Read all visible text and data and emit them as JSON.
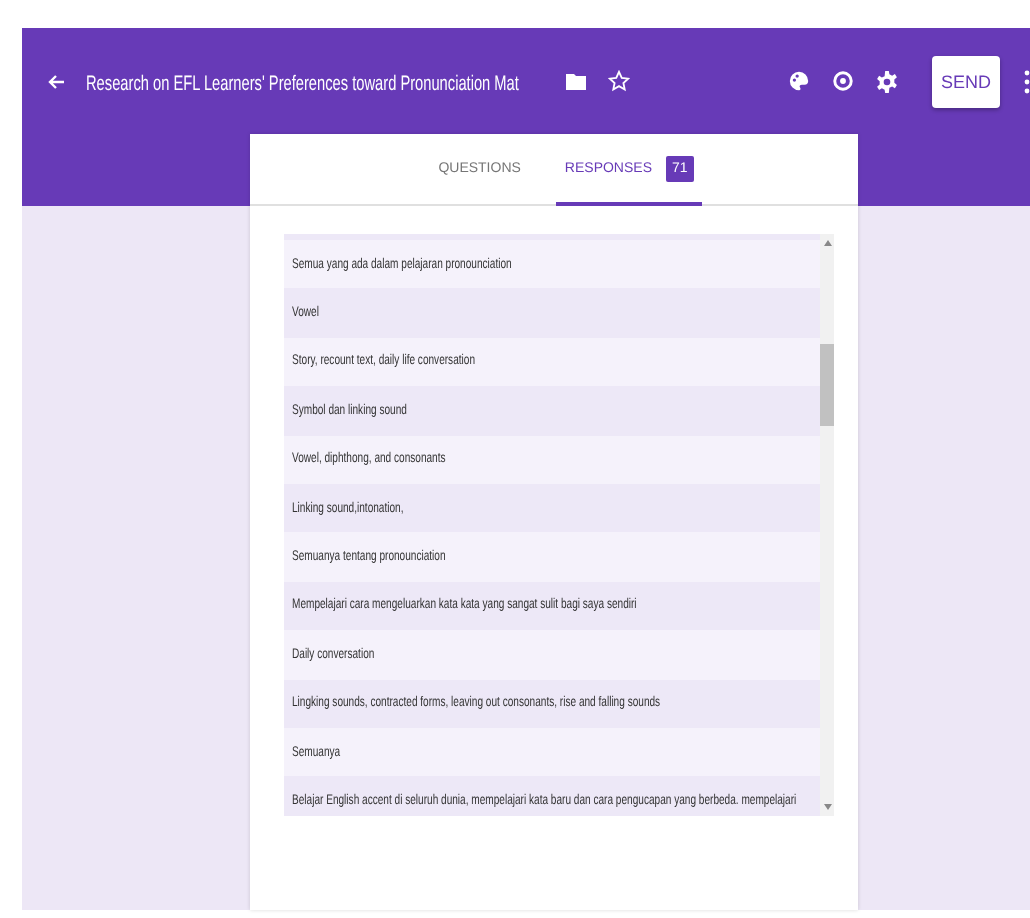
{
  "header": {
    "title": "Research on EFL Learners' Preferences toward Pronunciation Mat",
    "send_label": "SEND"
  },
  "tabs": [
    {
      "label": "QUESTIONS",
      "selected": false
    },
    {
      "label": "RESPONSES",
      "selected": true,
      "badge": "71"
    }
  ],
  "responses": [
    "Semua yang ada dalam pelajaran pronounciation",
    "Vowel",
    "Story, recount text, daily life conversation",
    "Symbol dan linking sound",
    "Vowel, diphthong, and consonants",
    "Linking sound,intonation,",
    "Semuanya tentang pronounciation",
    "Mempelajari cara mengeluarkan kata kata yang sangat sulit bagi saya sendiri",
    "Daily conversation",
    "Lingking sounds, contracted forms, leaving out consonants, rise and falling sounds",
    "Semuanya",
    "Belajar English accent di seluruh dunia, mempelajari kata baru dan cara pengucapan yang berbeda. mempelajari"
  ]
}
